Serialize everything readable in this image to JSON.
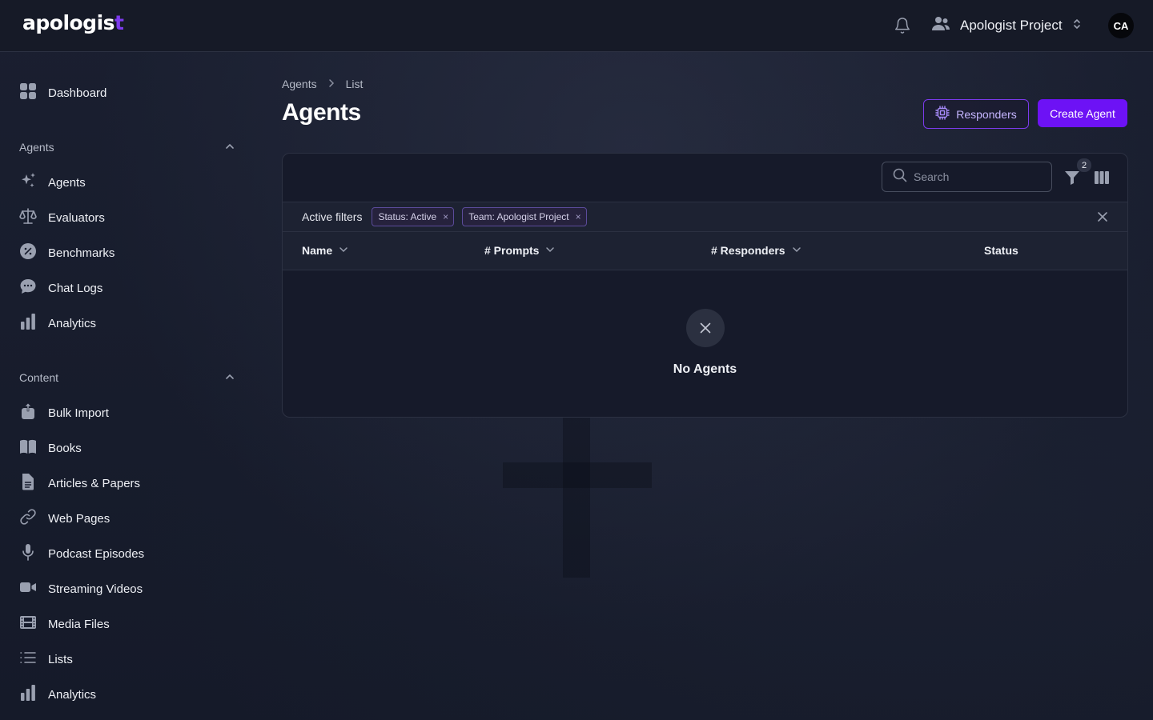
{
  "topbar": {
    "logo_text": "apologis",
    "logo_accent": "t",
    "team_name": "Apologist Project",
    "avatar_initials": "CA"
  },
  "sidebar": {
    "dashboard_label": "Dashboard",
    "sections": {
      "agents": {
        "title": "Agents",
        "items": [
          {
            "label": "Agents",
            "icon": "sparkles-icon"
          },
          {
            "label": "Evaluators",
            "icon": "scale-icon"
          },
          {
            "label": "Benchmarks",
            "icon": "percent-badge-icon"
          },
          {
            "label": "Chat Logs",
            "icon": "chat-bubble-icon"
          },
          {
            "label": "Analytics",
            "icon": "bar-chart-icon"
          }
        ]
      },
      "content": {
        "title": "Content",
        "items": [
          {
            "label": "Bulk Import",
            "icon": "upload-icon"
          },
          {
            "label": "Books",
            "icon": "book-icon"
          },
          {
            "label": "Articles & Papers",
            "icon": "document-icon"
          },
          {
            "label": "Web Pages",
            "icon": "link-icon"
          },
          {
            "label": "Podcast Episodes",
            "icon": "microphone-icon"
          },
          {
            "label": "Streaming Videos",
            "icon": "video-camera-icon"
          },
          {
            "label": "Media Files",
            "icon": "film-icon"
          },
          {
            "label": "Lists",
            "icon": "list-icon"
          },
          {
            "label": "Analytics",
            "icon": "bar-chart-icon"
          }
        ]
      }
    }
  },
  "main": {
    "breadcrumb": [
      "Agents",
      "List"
    ],
    "title": "Agents",
    "responders_button": "Responders",
    "create_button": "Create Agent",
    "search_placeholder": "Search",
    "filter_count": "2",
    "active_filters_label": "Active filters",
    "filters": [
      "Status: Active",
      "Team: Apologist Project"
    ],
    "columns": [
      "Name",
      "# Prompts",
      "# Responders",
      "Status"
    ],
    "empty_text": "No Agents"
  },
  "colors": {
    "accent": "#6d12f5",
    "accent_border": "#7c3aed",
    "background": "#161b2c"
  }
}
